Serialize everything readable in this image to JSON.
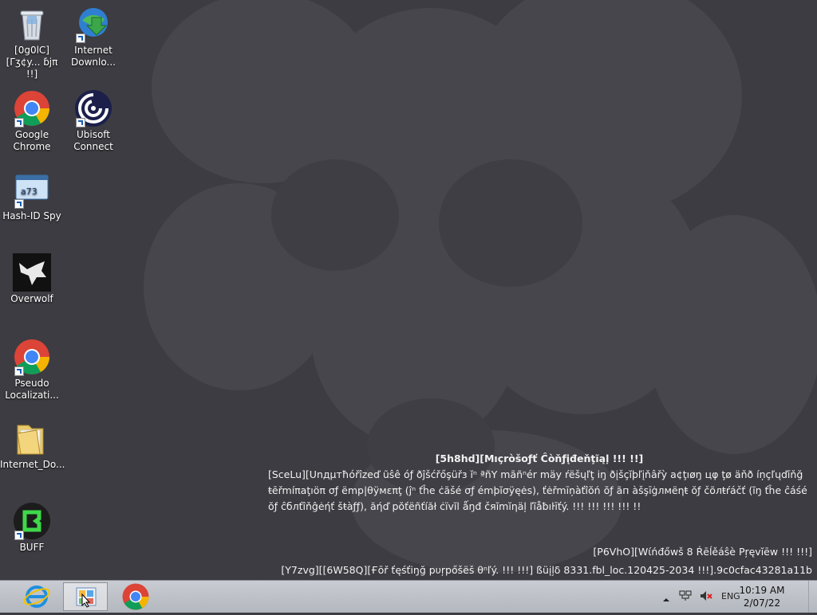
{
  "desktop": {
    "icons": [
      {
        "label": "[0g0lC][Γʒ¢y... ɓjπ !!]",
        "icon": "recycle-bin-icon"
      },
      {
        "label": "Internet Downlo...",
        "icon": "internet-download-manager-icon"
      },
      {
        "label": "Google Chrome",
        "icon": "chrome-icon"
      },
      {
        "label": "Ubisoft Connect",
        "icon": "ubisoft-icon"
      },
      {
        "label": "Hash-ID Spy",
        "icon": "hash-id-spy-icon"
      },
      {
        "label": "Overwolf",
        "icon": "overwolf-icon"
      },
      {
        "label": "Pseudo Localizati...",
        "icon": "chrome-icon"
      },
      {
        "label": "Internet_Do...",
        "icon": "folder-icon"
      },
      {
        "label": "BUFF",
        "icon": "buff-icon"
      }
    ]
  },
  "notice": {
    "title": "[5h8hd][Mıçròšoƒť Ĉòňƒįđeňţĩąļ !!! !!]",
    "body": "[SceLu][Սnдμтħóřîzeď ũŝê óƒ ðĵšćřőşüřз ĭⁿ ªñY mãñⁿér mäy ŕëšųľţ iŋ ðįšçĭþľįňâřỳ a¢ţıøŋ цφ ţø äňð íņçľųďīňğ ŧēřmíπaţıöπ σƒ ëmp|θÿмεπţ (ĵⁿ ťĥe ċãšé σƒ émþĭσÿęės), ťėřmīņàťîŏń ŏƒ ãп àšşīġлмëηŧ ŏƒ čõлŧŕáčť (ĩŋ ťĥe ĉáśé ŏƒ ĉблťîňĝėήť šŧàƒƒ), ăήď pŏťëñťíăł ċïvĭl ǻŋđ čяĭmĭηäļ ľĩåƀıŀīťý. !!! !!! !!! !!! !!"
  },
  "watermark": {
    "line1": "[P6VhO][Wίńđőwš 8 Ŕēĺěáŝè Pŗęvĭēw !!! !!!]",
    "line2": "[Y7zvg][[6W58Q][Ғōř ťęśťiŋğ pυŗpőšëš θⁿľý. !!! !!!] ßüįļδ 8331.fbl_loc.120425-2034 !!!].9c0cfac43281a11b"
  },
  "taskbar": {
    "items": [
      {
        "icon": "internet-explorer-icon",
        "active": false
      },
      {
        "icon": "control-panel-icon",
        "active": true
      },
      {
        "icon": "chrome-icon",
        "active": false
      }
    ],
    "tray": {
      "language": "ENG",
      "time": "10:19 AM",
      "date": "2/07/22"
    }
  },
  "colors": {
    "desktop_background": "#3c3c42",
    "taskbar": "#c0c3c9"
  }
}
